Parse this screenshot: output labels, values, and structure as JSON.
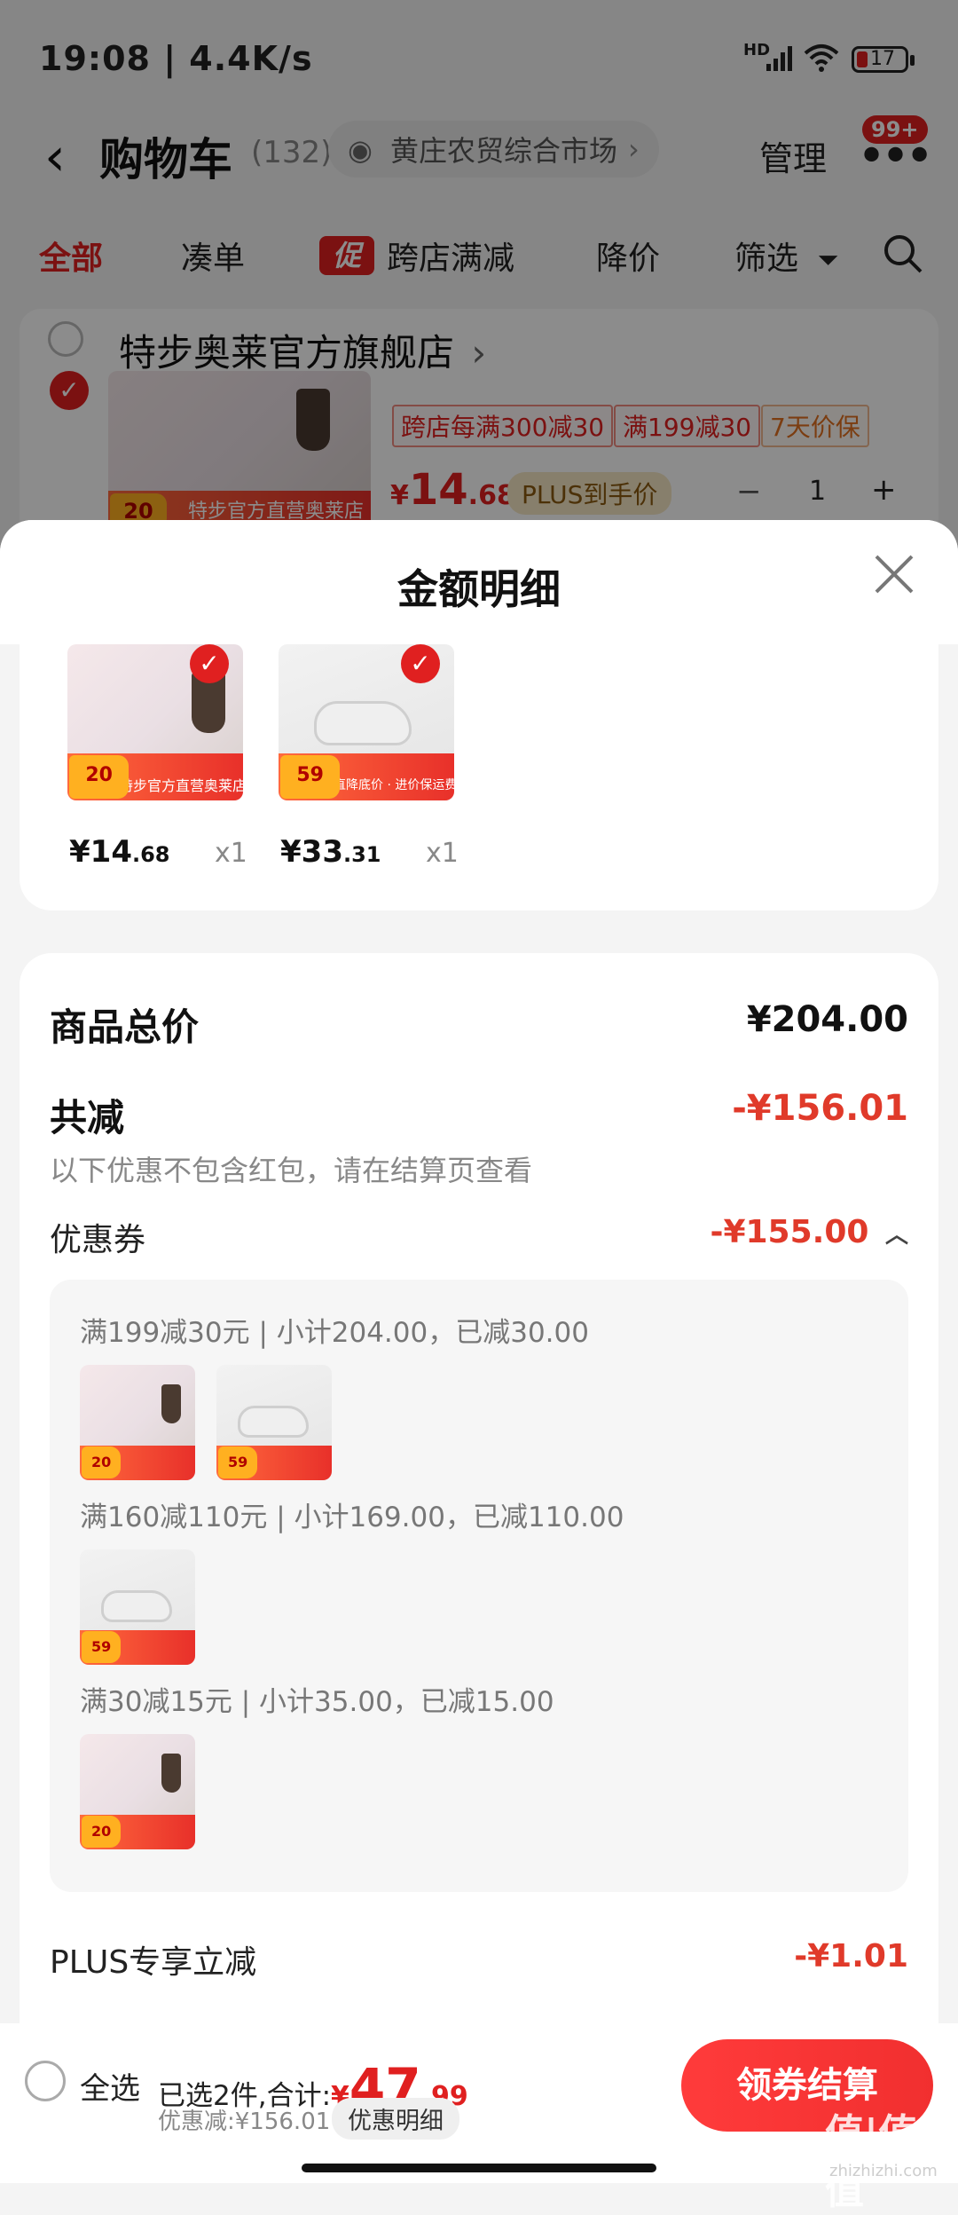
{
  "status_bar": {
    "time": "19:08 | 4.4K/s",
    "network": "HD",
    "battery": "17"
  },
  "header": {
    "title": "购物车",
    "count": "(132)",
    "location": "黄庄农贸综合市场",
    "manage": "管理",
    "badge": "99+"
  },
  "filters": {
    "all": "全部",
    "bundle": "凑单",
    "promo_tag": "促",
    "cross_store": "跨店满减",
    "price_drop": "降价",
    "filter": "筛选"
  },
  "store": {
    "name": "特步奥莱官方旗舰店",
    "tags": [
      "跨店每满300减30",
      "满199减30",
      "7天价保"
    ],
    "price_symbol": "¥",
    "price_int": "14",
    "price_dec": ".68",
    "plus_label": "PLUS到手价",
    "qty": "1",
    "thumb_text": "特步官方直营奥莱店",
    "thumb_num": "20"
  },
  "sheet": {
    "title": "金额明细",
    "items": [
      {
        "price_int": "¥14",
        "price_dec": ".68",
        "qty": "x1",
        "banner": "特步官方直营奥莱店",
        "num": "20"
      },
      {
        "price_int": "¥33",
        "price_dec": ".31",
        "qty": "x1",
        "banner": "直降底价 · 进价保运费险",
        "num": "59"
      }
    ],
    "total_label": "商品总价",
    "total_value": "¥204.00",
    "discount_label": "共减",
    "discount_value": "-¥156.01",
    "discount_note": "以下优惠不包含红包，请在结算页查看",
    "coupon_label": "优惠券",
    "coupon_value": "-¥155.00",
    "coupon_rules": [
      "满199减30元 | 小计204.00，已减30.00",
      "满160减110元 | 小计169.00，已减110.00",
      "满30减15元 | 小计35.00，已减15.00"
    ],
    "plus_label": "PLUS专享立减",
    "plus_value": "-¥1.01"
  },
  "footer": {
    "select_all": "全选",
    "summary_prefix": "已选2件,合计:",
    "currency": "¥",
    "total_int": "47",
    "total_dec": ".99",
    "discount": "优惠减:¥156.01",
    "detail_button": "优惠明细",
    "checkout": "领券结算"
  },
  "watermark": {
    "main": "值|值|值",
    "url": "zhizhizhi.com"
  },
  "colors": {
    "accent": "#e02020",
    "discount": "#e03a2a",
    "plus": "#f6e7c5"
  }
}
